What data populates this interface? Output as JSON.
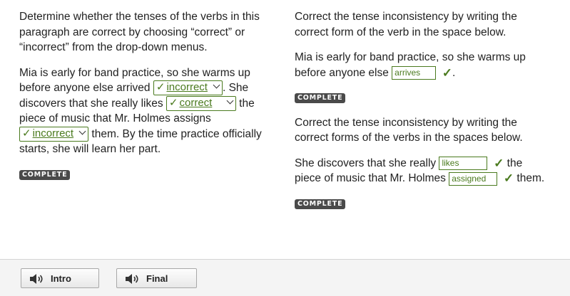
{
  "left": {
    "instructions": "Determine whether the tenses of the verbs in this paragraph are correct by choosing “correct” or “incorrect” from the drop-down menus.",
    "p1": "Mia is early for band practice, so she warms up before anyone else arrived",
    "p2": ". She discovers that she really likes",
    "p3": "the piece of music that Mr. Holmes assigns",
    "p4": "them. By the time practice officially starts, she will learn her part.",
    "dropdown1": "incorrect",
    "dropdown2": "correct",
    "dropdown3": "incorrect",
    "complete_badge": "COMPLETE"
  },
  "right1": {
    "instructions": "Correct the tense inconsistency by writing the correct form of the verb in the space below.",
    "p1": "Mia is early for band practice, so she warms up before anyone else",
    "input": "arrives",
    "end": ".",
    "complete_badge": "COMPLETE"
  },
  "right2": {
    "instructions": "Correct the tense inconsistency by writing the correct forms of the verbs in the spaces below.",
    "p1": "She discovers that she really",
    "input1": "likes",
    "p2": "the piece of music that Mr. Holmes",
    "input2": "assigned",
    "end": "them.",
    "complete_badge": "COMPLETE"
  },
  "check_glyph": "✓",
  "footer": {
    "intro_label": "Intro",
    "final_label": "Final"
  },
  "colors": {
    "correct_green": "#4a7a1e",
    "badge_bg": "#4a4a4a"
  }
}
